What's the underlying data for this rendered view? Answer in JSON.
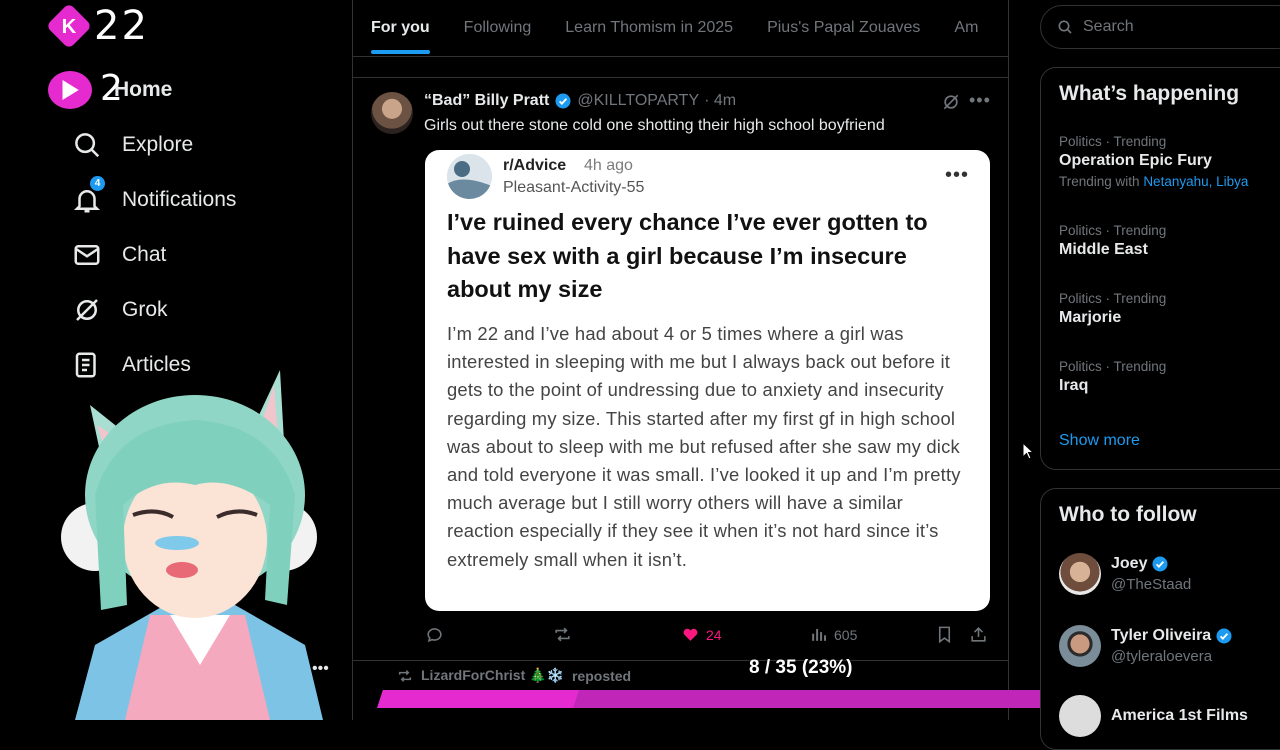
{
  "logo": {
    "badge_letter": "K",
    "text": "22"
  },
  "sidebar": {
    "home": {
      "badge_text": "2",
      "label": "Home"
    },
    "items": [
      {
        "label": "Explore",
        "icon": "search-icon"
      },
      {
        "label": "Notifications",
        "icon": "bell-icon",
        "badge": "4"
      },
      {
        "label": "Chat",
        "icon": "envelope-icon"
      },
      {
        "label": "Grok",
        "icon": "grok-icon"
      },
      {
        "label": "Articles",
        "icon": "article-icon"
      }
    ]
  },
  "tabs": [
    "For you",
    "Following",
    "Learn Thomism in 2025",
    "Pius's Papal Zouaves",
    "Am"
  ],
  "post": {
    "author": "“Bad” Billy Pratt",
    "handle": "@KILLTOPARTY",
    "time": "· 4m",
    "text": "Girls out there stone cold one shotting their high school boyfriend",
    "card": {
      "subreddit": "r/Advice",
      "age": "4h ago",
      "user": "Pleasant-Activity-55",
      "title": "I’ve ruined every chance I’ve ever gotten to have sex with a girl because I’m insecure about my size",
      "body": "I’m 22 and I’ve had about 4 or 5 times where a girl was interested in sleeping with me but I always back out before it gets to the point of undressing due to anxiety and insecurity regarding my size. This started after my first gf in high school was about to sleep with me but refused after she saw my dick and told everyone it was small. I’ve looked it up and I’m pretty much average but I still worry others will have a similar reaction especially if they see it when it’s not hard since it’s extremely small when it isn’t."
    },
    "likes": "24",
    "views": "605"
  },
  "next_post": {
    "reposted_by": "LizardForChrist 🎄❄️",
    "reposted_label": "reposted"
  },
  "progress": {
    "label": "8 / 35 (23%)",
    "fraction": 0.23
  },
  "search": {
    "placeholder": "Search"
  },
  "trends": {
    "title": "What’s happening",
    "items": [
      {
        "meta": "Politics · Trending",
        "name": "Operation Epic Fury",
        "with_label": "Trending with",
        "with_links": "Netanyahu, Libya"
      },
      {
        "meta": "Politics · Trending",
        "name": "Middle East"
      },
      {
        "meta": "Politics · Trending",
        "name": "Marjorie"
      },
      {
        "meta": "Politics · Trending",
        "name": "Iraq"
      }
    ],
    "show_more": "Show more"
  },
  "who_to_follow": {
    "title": "Who to follow",
    "items": [
      {
        "name": "Joey",
        "handle": "@TheStaad"
      },
      {
        "name": "Tyler Oliveira",
        "handle": "@tyleraloevera"
      },
      {
        "name": "America 1st Films"
      }
    ]
  },
  "colors": {
    "accent": "#1d9bf0",
    "brand": "#e52bd0",
    "like": "#f91880"
  }
}
